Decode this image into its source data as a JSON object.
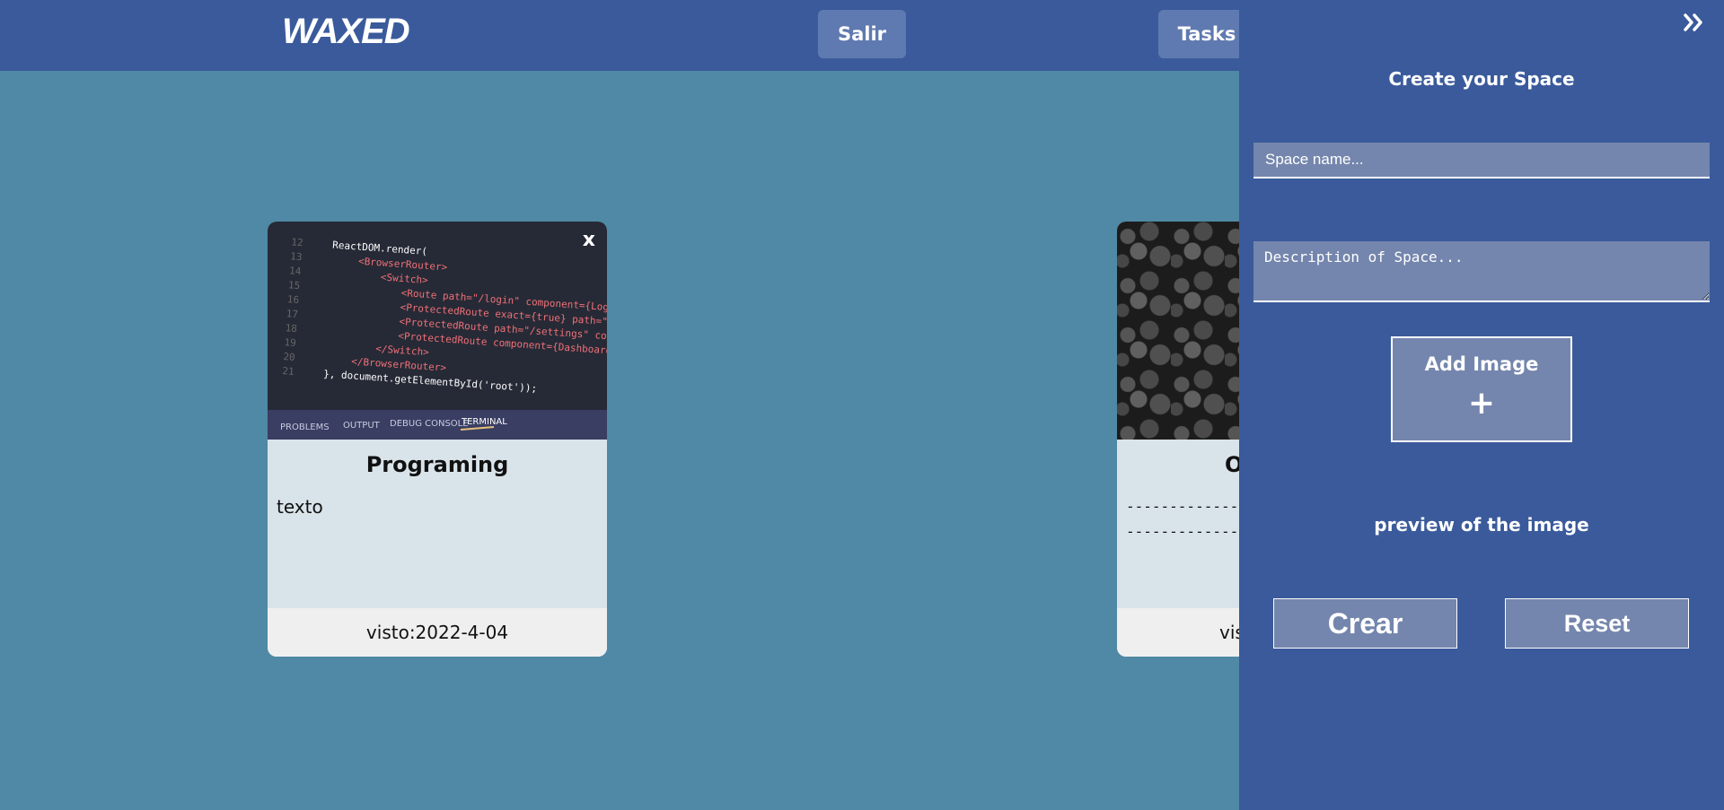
{
  "navbar": {
    "brand": "WAXED",
    "salir_label": "Salir",
    "tasks_label": "Tasks"
  },
  "cards": [
    {
      "title": "Programing",
      "text": "texto",
      "footer": "visto:2022-4-04",
      "close_label": "x",
      "image_icon": "code-screenshot-image"
    },
    {
      "title": "O",
      "dash_line_1": "-------------------",
      "dash_line_2": "-------------------",
      "footer": "vis",
      "image_icon": "black-pebbles-image"
    }
  ],
  "panel": {
    "title": "Create your Space",
    "name_placeholder": "Space name...",
    "name_value": "",
    "desc_placeholder": "Description of Space...",
    "desc_value": "",
    "add_image_label": "Add Image",
    "add_image_icon": "plus-icon",
    "preview_text": "preview of the image",
    "crear_label": "Crear",
    "reset_label": "Reset",
    "collapse_icon": "double-chevron-right-icon"
  },
  "code_snippet": {
    "lines": [
      "ReactDOM.render(",
      "<BrowserRouter>",
      "<Switch>",
      "<Route path=\"/login\" component={Login} />",
      "<ProtectedRoute exact={true} path=\"/\" component",
      "<ProtectedRoute path=\"/settings\" component",
      "<ProtectedRoute component={Dashboard} />",
      "</Switch>",
      "</BrowserRouter>",
      "}, document.getElementById('root'));"
    ],
    "tabs": [
      "PROBLEMS",
      "OUTPUT",
      "DEBUG CONSOLE",
      "TERMINAL"
    ]
  },
  "colors": {
    "background": "#4f89a6",
    "navbar": "#3a5a9b",
    "button": "#5f7ab0",
    "panel_field": "#7486ad",
    "card_body": "#d9e3ea",
    "card_footer": "#efefef"
  }
}
